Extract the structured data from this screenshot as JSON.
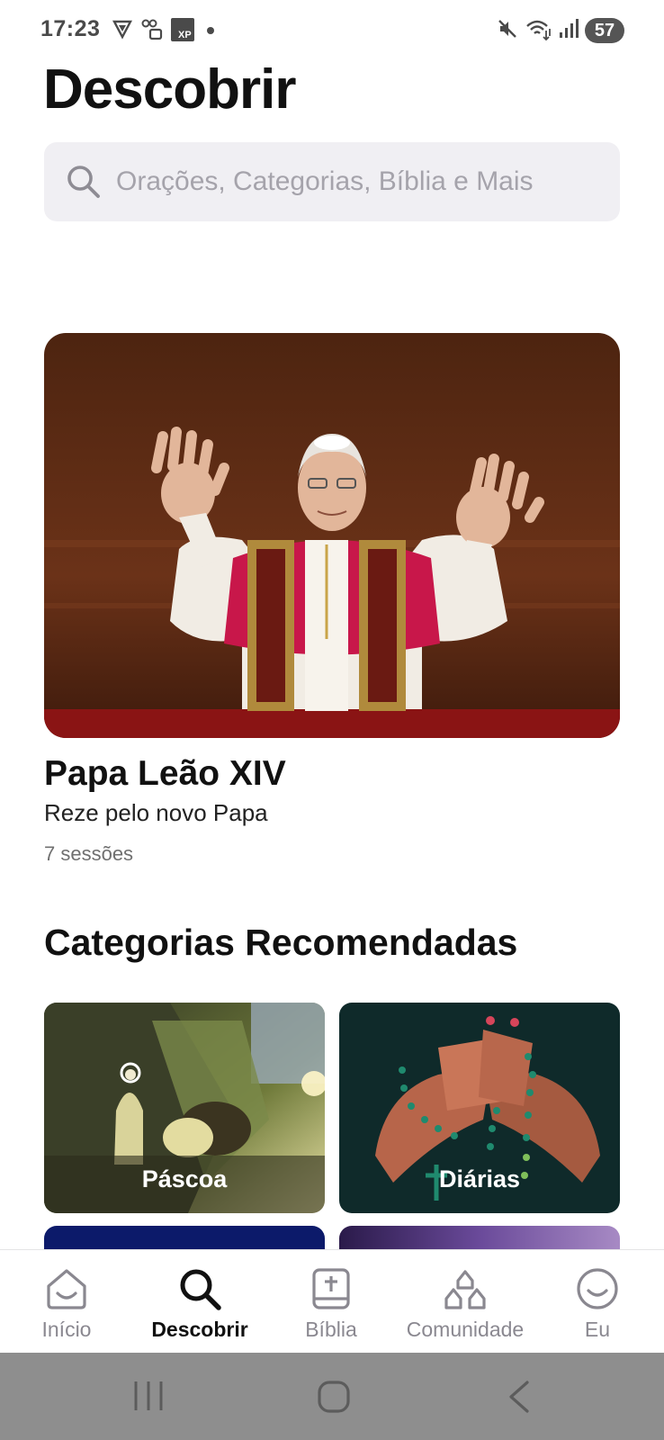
{
  "status_bar": {
    "time": "17:23",
    "battery": "57",
    "icons": [
      "vpn-shield-icon",
      "voicemail-lock-icon",
      "xp-app-icon",
      "notification-dot-icon",
      "muted-icon",
      "wifi-icon",
      "signal-icon"
    ]
  },
  "header": {
    "title": "Descobrir"
  },
  "search": {
    "placeholder": "Orações, Categorias, Bíblia e Mais",
    "value": ""
  },
  "featured": {
    "image": "pope-leo-xiv-balcony-photo",
    "title": "Papa Leão XIV",
    "subtitle": "Reze pelo novo Papa",
    "meta": "7 sessões"
  },
  "recommended": {
    "title": "Categorias Recomendadas",
    "cards": [
      {
        "label": "Páscoa",
        "image": "easter-tomb-illustration"
      },
      {
        "label": "Diárias",
        "image": "rosary-hands-illustration"
      }
    ]
  },
  "bottom_nav": {
    "items": [
      {
        "label": "Início",
        "icon": "home-icon",
        "active": false
      },
      {
        "label": "Descobrir",
        "icon": "search-icon",
        "active": true
      },
      {
        "label": "Bíblia",
        "icon": "bible-icon",
        "active": false
      },
      {
        "label": "Comunidade",
        "icon": "community-icon",
        "active": false
      },
      {
        "label": "Eu",
        "icon": "profile-smile-icon",
        "active": false
      }
    ]
  },
  "system_nav": [
    "recents-icon",
    "home-circle-icon",
    "back-icon"
  ],
  "colors": {
    "search_bg": "#f0eff3",
    "accent_text": "#111111",
    "muted_text": "#8a8890",
    "feature_bg": "#5a2a14",
    "card_daily_bg": "#0f2a2a"
  }
}
